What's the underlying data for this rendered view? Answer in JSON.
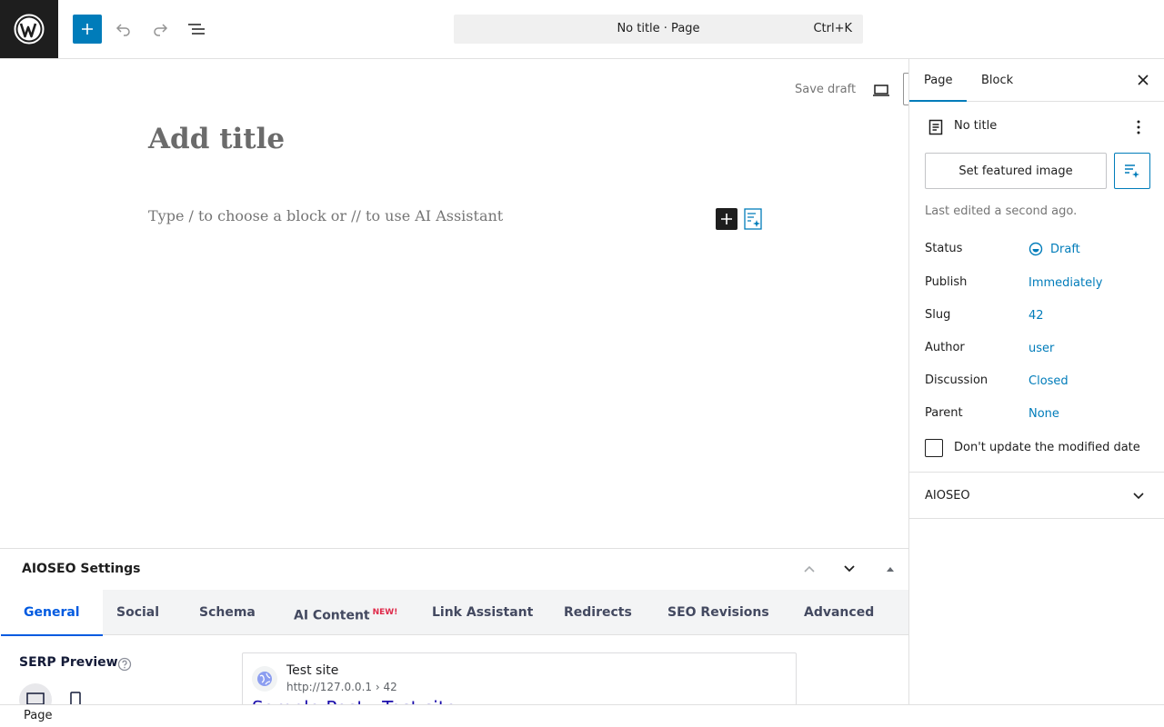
{
  "topbar": {
    "document_title": "No title · Page",
    "shortcut": "Ctrl+K",
    "icons": [
      "wordpress-logo",
      "plus-icon",
      "undo-icon",
      "redo-icon",
      "list-view-icon"
    ]
  },
  "editor": {
    "save_draft": "Save draft",
    "title_placeholder": "Add title",
    "block_placeholder": "Type / to choose a block or // to use AI Assistant"
  },
  "metabox": {
    "title": "AIOSEO Settings",
    "tabs": [
      {
        "label": "General",
        "active": true
      },
      {
        "label": "Social"
      },
      {
        "label": "Schema"
      },
      {
        "label": "AI Content",
        "badge": "NEW!"
      },
      {
        "label": "Link Assistant"
      },
      {
        "label": "Redirects"
      },
      {
        "label": "SEO Revisions"
      },
      {
        "label": "Advanced"
      }
    ],
    "serp_label": "SERP Preview",
    "serp": {
      "site_name": "Test site",
      "url": "http://127.0.0.1 › 42",
      "link_title": "Sample Post - Test site"
    }
  },
  "sidebar": {
    "tabs": [
      "Page",
      "Block"
    ],
    "doc_title": "No title",
    "featured_image": "Set featured image",
    "last_edited": "Last edited a second ago.",
    "props": [
      {
        "label": "Status",
        "value": "Draft"
      },
      {
        "label": "Publish",
        "value": "Immediately"
      },
      {
        "label": "Slug",
        "value": "42"
      },
      {
        "label": "Author",
        "value": "user"
      },
      {
        "label": "Discussion",
        "value": "Closed"
      },
      {
        "label": "Parent",
        "value": "None"
      }
    ],
    "checkbox_label": "Don't update the modified date",
    "aioseo_panel": "AIOSEO"
  },
  "footer": {
    "breadcrumb": "Page"
  },
  "colors": {
    "accent": "#007cba",
    "aioseo_blue": "#005ae0",
    "new_badge": "#df2a4a"
  }
}
